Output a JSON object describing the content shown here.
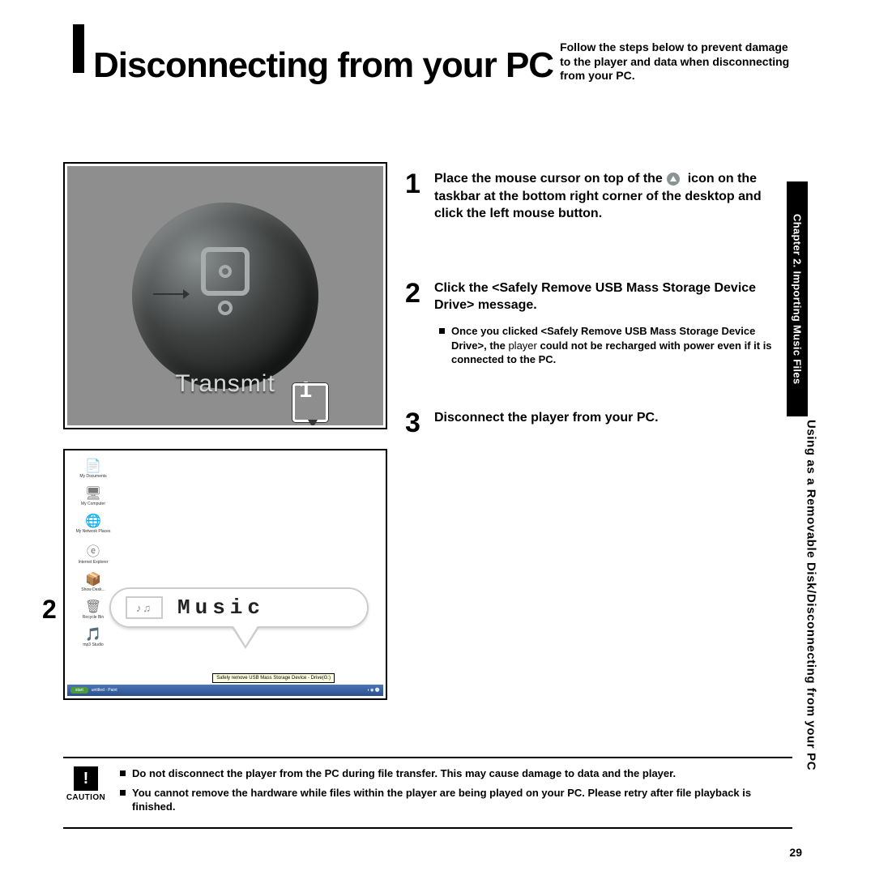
{
  "page": {
    "title": "Disconnecting from your PC",
    "subtitle": "Follow the steps below to prevent damage to the player and data when disconnecting from your PC.",
    "number": "29"
  },
  "side_tab": {
    "chapter": "Chapter 2. Importing Music Files",
    "section_line1": "Using as a Removable Disk/",
    "section_line2": "Disconnecting from your PC"
  },
  "figure1": {
    "label": "Transmit",
    "callout_num": "1"
  },
  "figure2": {
    "callout_num": "2",
    "music_label": "Music",
    "music_glyph": "♪♫",
    "taskbar_start": "start",
    "taskbar_task": "untitled - Paint",
    "taskbar_tooltip": "Safely remove USB Mass Storage Device - Drive(G:)",
    "desktop_icons": [
      {
        "g": "📄",
        "l": "My Documents"
      },
      {
        "g": "🖥",
        "l": "My Computer"
      },
      {
        "g": "🌐",
        "l": "My Network Places"
      },
      {
        "g": "ⓔ",
        "l": "Internet Explorer"
      },
      {
        "g": "📦",
        "l": "Show Desk..."
      },
      {
        "g": "🗑",
        "l": "Recycle Bin"
      },
      {
        "g": "🎵",
        "l": "mp3 Studio"
      }
    ]
  },
  "steps": [
    {
      "num": "1",
      "main_a": "Place the mouse cursor on top of the",
      "main_b": "icon on the taskbar at the bottom right corner of the desktop and click the left mouse button."
    },
    {
      "num": "2",
      "main": "Click the <Safely Remove USB Mass Storage Device Drive> message.",
      "bullet_bold": "Once you clicked <Safely Remove USB Mass Storage Device Drive>, the ",
      "bullet_normal_inline": "player",
      "bullet_bold_tail": " could not be recharged with power even if it is connected to the PC."
    },
    {
      "num": "3",
      "main": "Disconnect the player from your PC."
    }
  ],
  "caution": {
    "label": "CAUTION",
    "symbol": "!",
    "bullets": [
      "Do not disconnect the player from the PC during file transfer. This may cause damage to data and the player.",
      "You cannot remove the hardware while files within the player are being played on your PC. Please retry after file playback is finished."
    ]
  }
}
